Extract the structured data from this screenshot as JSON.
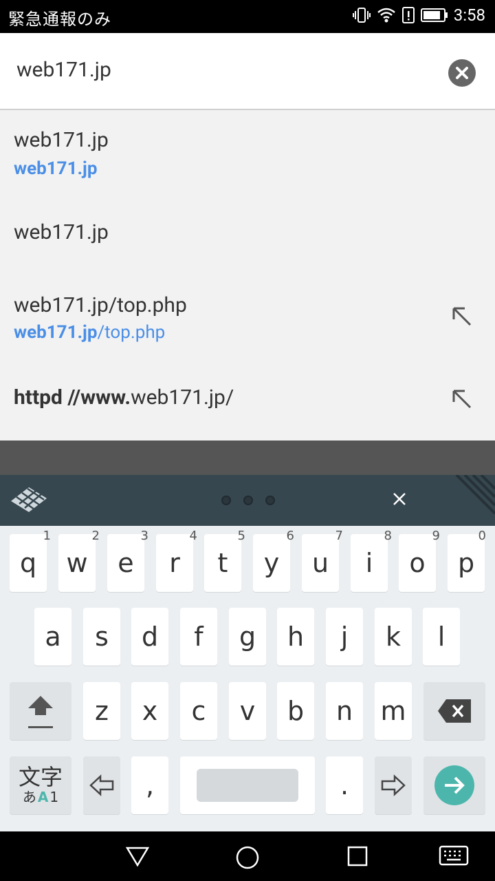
{
  "status_bar": {
    "carrier": "緊急通報のみ",
    "time": "3:58"
  },
  "omnibox": {
    "url": "web171.jp"
  },
  "suggestions": [
    {
      "title": "web171.jp",
      "sub_bold": "web171.jp",
      "sub_rest": ""
    },
    {
      "title": "web171.jp"
    },
    {
      "title": "web171.jp/top.php",
      "sub_bold": "web171.jp",
      "sub_rest": "/top.php"
    },
    {
      "title_bold": "httpd //www.",
      "title_rest": "web171.jp/"
    }
  ],
  "keyboard": {
    "row1": [
      {
        "key": "q",
        "hint": "1"
      },
      {
        "key": "w",
        "hint": "2"
      },
      {
        "key": "e",
        "hint": "3"
      },
      {
        "key": "r",
        "hint": "4"
      },
      {
        "key": "t",
        "hint": "5"
      },
      {
        "key": "y",
        "hint": "6"
      },
      {
        "key": "u",
        "hint": "7"
      },
      {
        "key": "i",
        "hint": "8"
      },
      {
        "key": "o",
        "hint": "9"
      },
      {
        "key": "p",
        "hint": "0"
      }
    ],
    "row2": [
      "a",
      "s",
      "d",
      "f",
      "g",
      "h",
      "j",
      "k",
      "l"
    ],
    "row3": [
      "z",
      "x",
      "c",
      "v",
      "b",
      "n",
      "m"
    ],
    "bottom": {
      "mode_top": "文字",
      "mode_bottom_a": "あ",
      "mode_bottom_b": "A",
      "mode_bottom_c": "1",
      "comma": ",",
      "period": "."
    }
  },
  "colors": {
    "accent_blue": "#4a8ee6",
    "enter_teal": "#4db6ac",
    "toolbar": "#37474f"
  }
}
